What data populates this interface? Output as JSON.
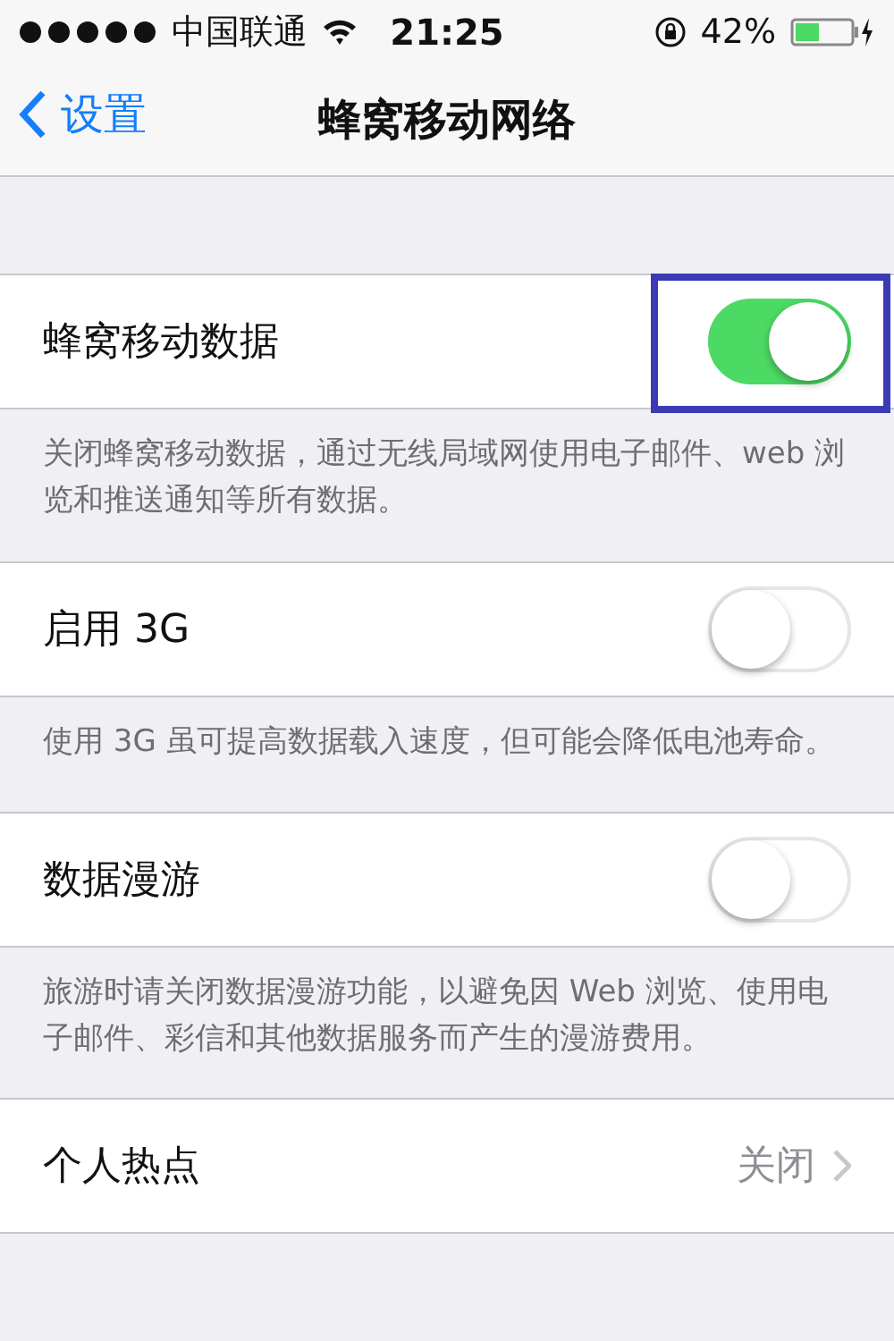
{
  "status_bar": {
    "carrier": "中国联通",
    "time": "21:25",
    "battery": "42%"
  },
  "nav": {
    "back": "设置",
    "title": "蜂窝移动网络"
  },
  "sections": [
    {
      "label": "蜂窝移动数据",
      "kind": "toggle",
      "on": true,
      "highlighted": true,
      "footer": "关闭蜂窝移动数据，通过无线局域网使用电子邮件、web 浏览和推送通知等所有数据。"
    },
    {
      "label": "启用 3G",
      "kind": "toggle",
      "on": false,
      "highlighted": false,
      "footer": "使用 3G 虽可提高数据载入速度，但可能会降低电池寿命。"
    },
    {
      "label": "数据漫游",
      "kind": "toggle",
      "on": false,
      "highlighted": false,
      "footer": "旅游时请关闭数据漫游功能，以避免因 Web 浏览、使用电子邮件、彩信和其他数据服务而产生的漫游费用。"
    },
    {
      "label": "个人热点",
      "kind": "link",
      "value": "关闭"
    }
  ]
}
